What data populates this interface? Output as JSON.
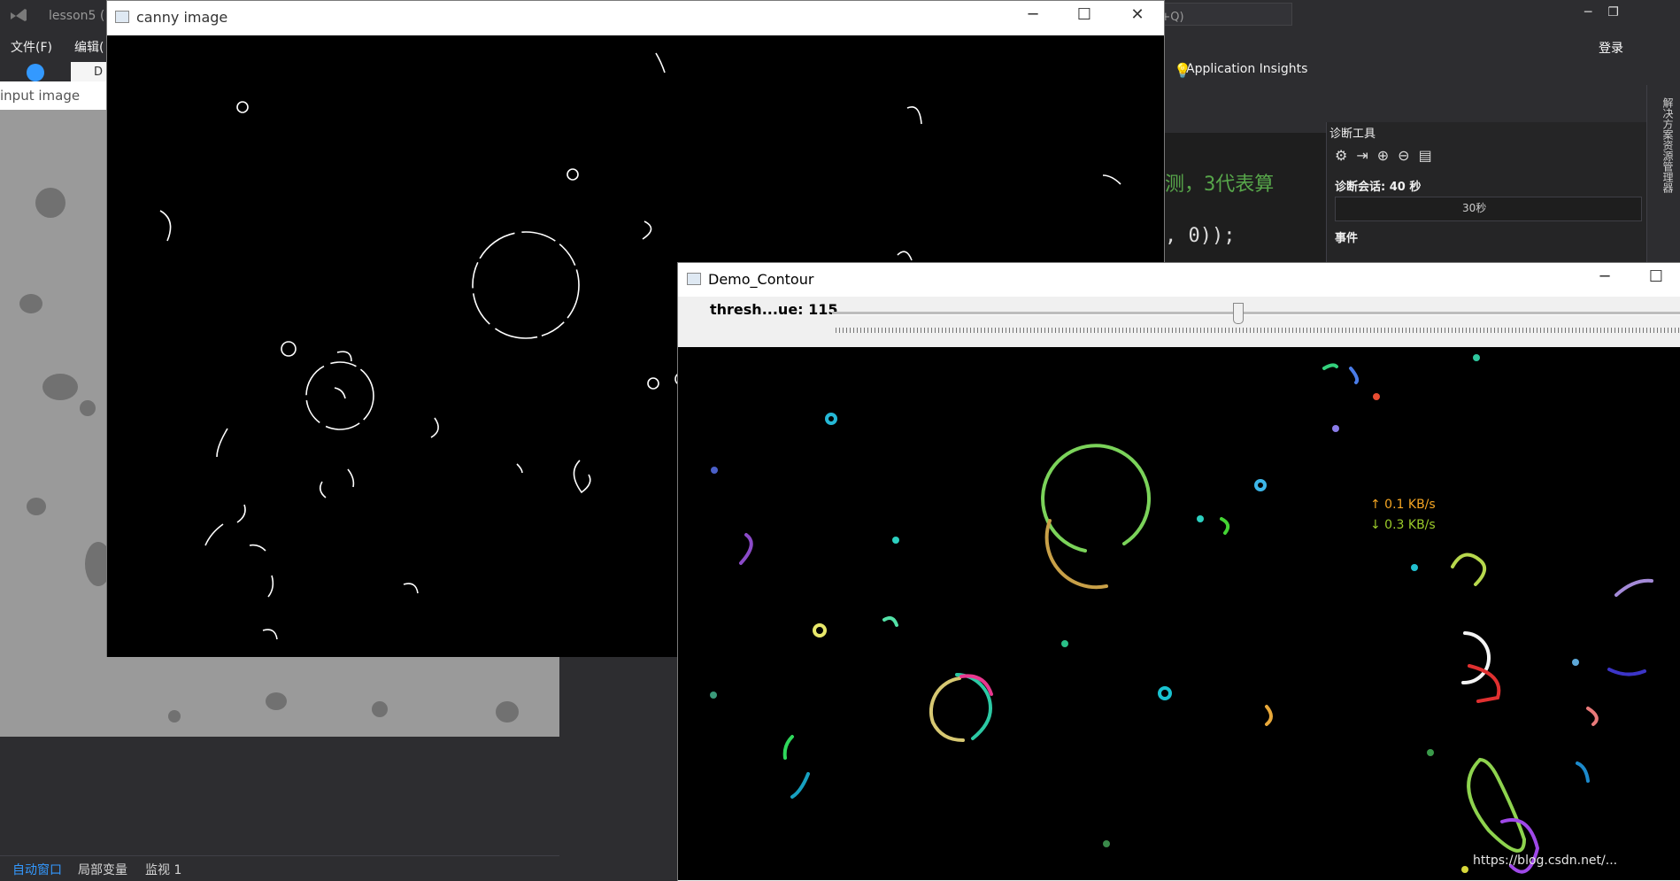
{
  "vs": {
    "title": "lesson5 (",
    "quick_launch_placeholder": "快速启动 (Ctrl+Q)",
    "login": "登录",
    "menu": [
      "文件(F)",
      "编辑("
    ],
    "doc_tab_fragment": "D",
    "app_insights": "Application Insights",
    "code_line1": "测，3代表算",
    "code_line2": ", 0));",
    "diag_title": "诊断工具",
    "diag_session": "诊断会话: 40 秒",
    "diag_tick": "30秒",
    "diag_events": "事件",
    "right_strip_text": "解决方案资源管理器",
    "bottom_tabs": [
      "自动窗口",
      "局部变量",
      "监视 1"
    ]
  },
  "input_window": {
    "title": "input image"
  },
  "canny_window": {
    "title": "canny image"
  },
  "demo_window": {
    "title": "Demo_Contour",
    "trackbar_label": "thresh...ue: 115",
    "trackbar_value": 115
  },
  "network": {
    "up": "↑ 0.1 KB/s",
    "down": "↓ 0.3 KB/s"
  },
  "watermark": "https://blog.csdn.net/..."
}
